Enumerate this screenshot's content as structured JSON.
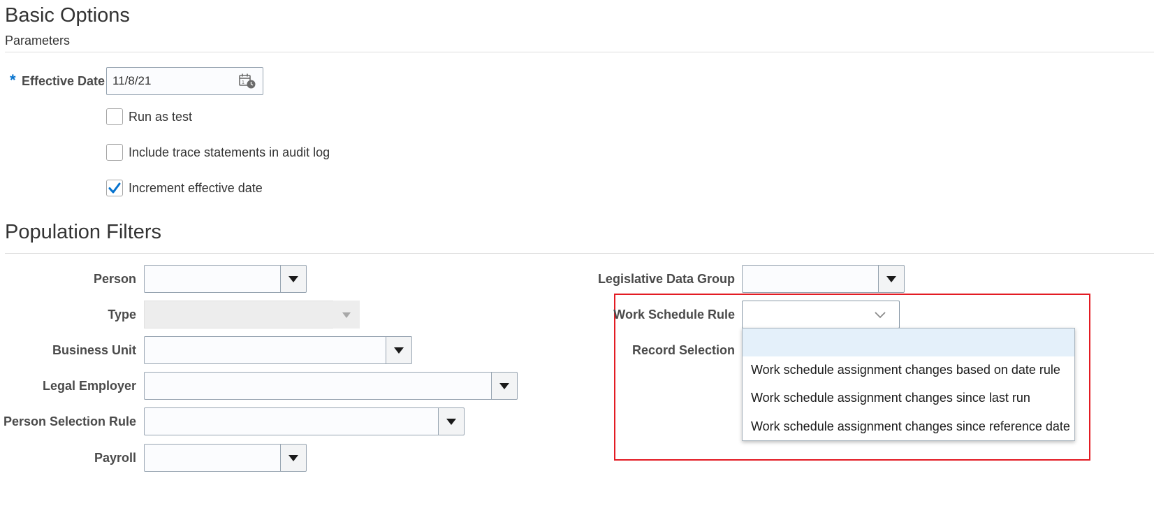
{
  "basic_options": {
    "title": "Basic Options",
    "parameters_heading": "Parameters",
    "effective_date": {
      "required_marker": "*",
      "label": "Effective Date",
      "value": "11/8/21",
      "icon": "calendar-icon"
    },
    "checkboxes": [
      {
        "label": "Run as test",
        "checked": false
      },
      {
        "label": "Include trace statements in audit log",
        "checked": false
      },
      {
        "label": "Increment effective date",
        "checked": true
      }
    ]
  },
  "population_filters": {
    "title": "Population Filters",
    "left_fields": [
      {
        "label": "Person",
        "value": ""
      },
      {
        "label": "Type",
        "value": "",
        "disabled": true
      },
      {
        "label": "Business Unit",
        "value": ""
      },
      {
        "label": "Legal Employer",
        "value": ""
      },
      {
        "label": "Person Selection Rule",
        "value": ""
      },
      {
        "label": "Payroll",
        "value": ""
      }
    ],
    "legislative_data_group": {
      "label": "Legislative Data Group",
      "value": ""
    },
    "work_schedule_rule": {
      "label": "Work Schedule Rule",
      "value": "",
      "icon": "chevron-down-icon",
      "options": [
        "",
        "Work schedule assignment changes based on date rule",
        "Work schedule assignment changes since last run",
        "Work schedule assignment changes since reference date"
      ]
    },
    "record_selection": {
      "label": "Record Selection"
    }
  },
  "colors": {
    "required_star": "#0572ce",
    "checkmark": "#0572ce",
    "highlight_border": "#e31b23",
    "selected_option_bg": "#e4f0fa"
  }
}
